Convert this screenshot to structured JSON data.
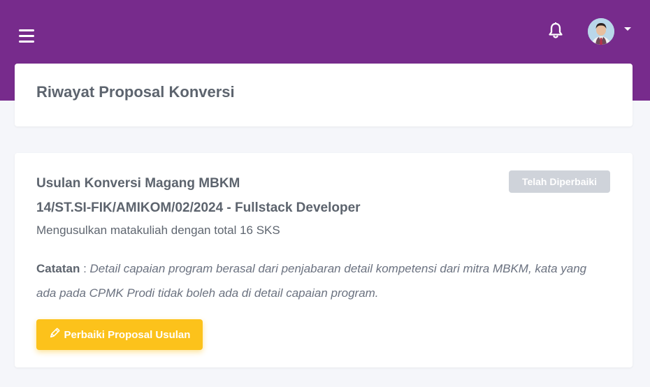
{
  "header": {
    "menu_icon": "hamburger-menu-icon",
    "notification_icon": "bell-icon",
    "avatar": "user-avatar",
    "dropdown_icon": "caret-down-icon"
  },
  "page": {
    "title": "Riwayat Proposal Konversi"
  },
  "proposal": {
    "title_line1": "Usulan Konversi Magang MBKM",
    "title_line2": "14/ST.SI-FIK/AMIKOM/02/2024 - Fullstack Developer",
    "status": "Telah Diperbaiki",
    "description": "Mengusulkan matakuliah dengan total 16 SKS",
    "note_label": "Catatan",
    "note_separator": " : ",
    "note_text": "Detail capaian program berasal dari penjabaran detail kompetensi dari mitra MBKM, kata yang ada pada CPMK Prodi tidak boleh ada di detail capaian program.",
    "action_label": "Perbaiki Proposal Usulan",
    "action_icon": "pencil-icon"
  },
  "colors": {
    "topbar": "#772b8c",
    "button": "#fcc21b",
    "badge": "#cfd3da",
    "background": "#f5f6fa"
  }
}
